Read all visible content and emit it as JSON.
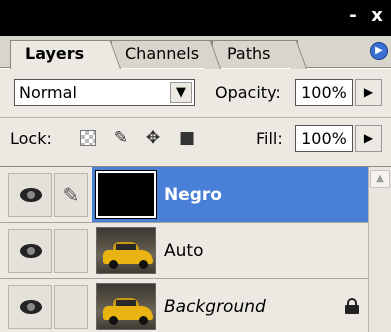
{
  "window": {
    "minimize_glyph": "-",
    "close_glyph": "x"
  },
  "tabs": [
    {
      "label": "Layers",
      "active": true
    },
    {
      "label": "Channels",
      "active": false
    },
    {
      "label": "Paths",
      "active": false
    }
  ],
  "menu_icon": "flyout-menu-icon",
  "blend_mode": {
    "value": "Normal"
  },
  "opacity": {
    "label": "Opacity:",
    "value": "100%"
  },
  "lock": {
    "label": "Lock:",
    "icons": [
      "lock-transparent-icon",
      "lock-image-icon",
      "lock-position-icon",
      "lock-all-icon"
    ]
  },
  "fill": {
    "label": "Fill:",
    "value": "100%"
  },
  "layers": [
    {
      "name": "Negro",
      "selected": true,
      "visible": true,
      "thumbnail": "black",
      "style": "bold",
      "locked": false
    },
    {
      "name": "Auto",
      "selected": false,
      "visible": true,
      "thumbnail": "car",
      "style": "normal",
      "locked": false
    },
    {
      "name": "Background",
      "selected": false,
      "visible": true,
      "thumbnail": "car",
      "style": "italic",
      "locked": true
    }
  ],
  "colors": {
    "selection": "#4a7fd8",
    "panel": "#ece9e2",
    "titlebar": "#000000"
  }
}
